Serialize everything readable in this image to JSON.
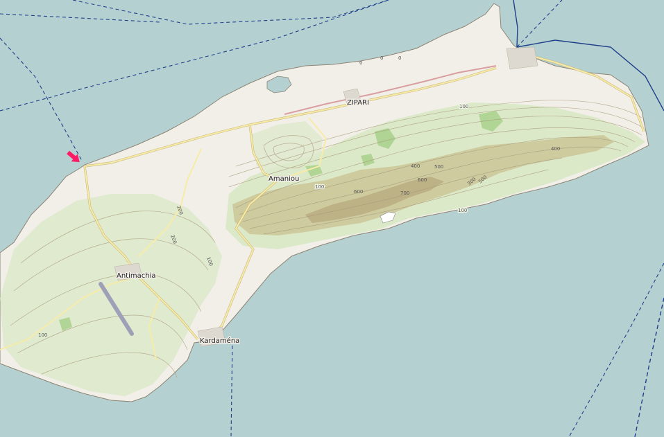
{
  "map": {
    "colors": {
      "sea": "#b5d0d0",
      "land": "#f2efe9",
      "hill_green": "#cfe3b6",
      "forest": "#a8d18c",
      "peak_brown": "#b7a57c",
      "contour": "#a8997a",
      "road": "#e8d99a",
      "road_outline": "#c9b77a",
      "primary_road": "#d99ea1",
      "boundary": "#1f3f8a",
      "marker": "#ff1a66"
    },
    "places": {
      "zipari": "ZIPARI",
      "amaniou": "Amaniou",
      "antimachia": "Antimachia",
      "kardamena": "Kardaména"
    },
    "elevations": {
      "e100_a": "100",
      "e100_b": "100",
      "e100_c": "100",
      "e100_d": "100",
      "e100_e": "100",
      "e200_a": "200",
      "e200_b": "200",
      "e300": "300",
      "e400_a": "400",
      "e400_b": "400",
      "e500_a": "500",
      "e500_b": "500",
      "e600_a": "600",
      "e600_b": "600",
      "e700": "700",
      "e0_a": "0",
      "e0_b": "0",
      "e0_c": "0"
    },
    "marker": {
      "icon": "arrow-marker-icon"
    }
  }
}
